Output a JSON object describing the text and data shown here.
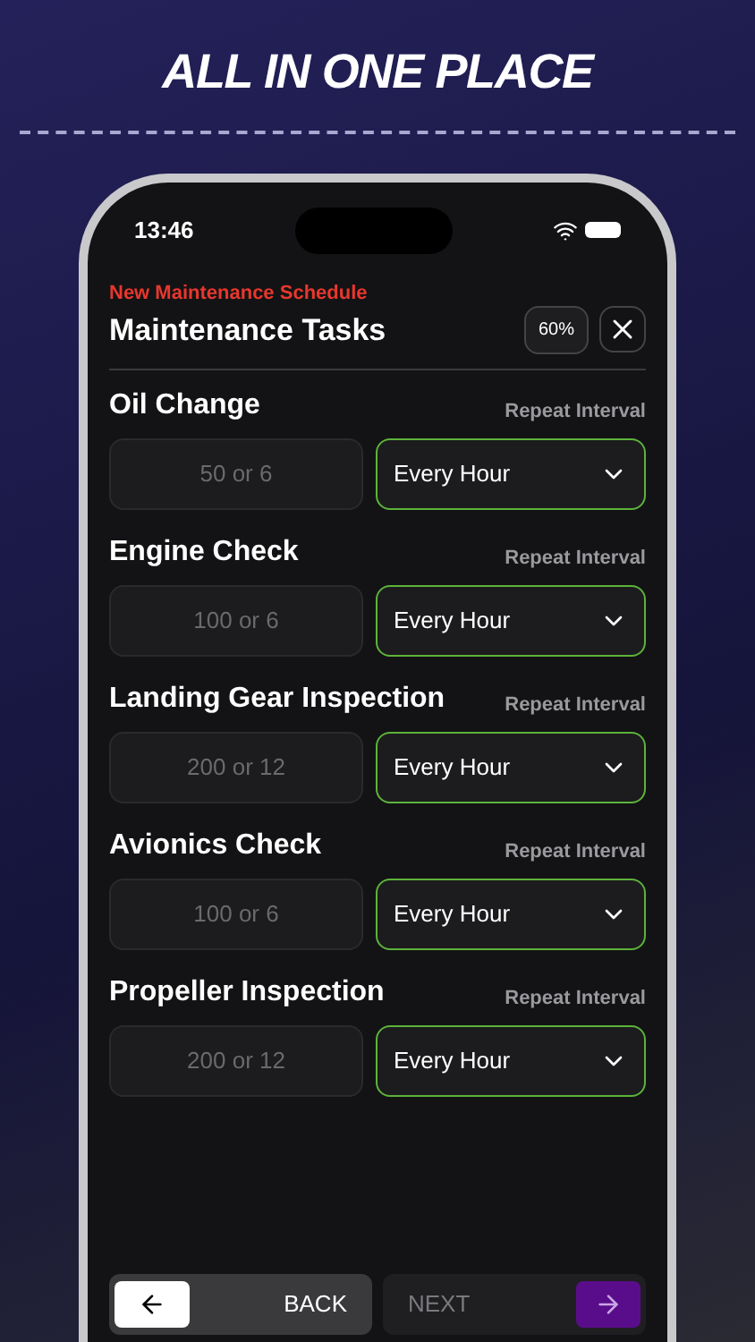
{
  "headline": "ALL IN ONE PLACE",
  "status_bar": {
    "time": "13:46"
  },
  "header": {
    "subtitle": "New Maintenance Schedule",
    "title": "Maintenance Tasks",
    "progress": "60%"
  },
  "tasks": [
    {
      "name": "Oil Change",
      "interval_label": "Repeat Interval",
      "placeholder": "50 or 6",
      "interval": "Every Hour"
    },
    {
      "name": "Engine Check",
      "interval_label": "Repeat Interval",
      "placeholder": "100 or 6",
      "interval": "Every Hour"
    },
    {
      "name": "Landing Gear Inspection",
      "interval_label": "Repeat Interval",
      "placeholder": "200 or 12",
      "interval": "Every Hour"
    },
    {
      "name": "Avionics Check",
      "interval_label": "Repeat Interval",
      "placeholder": "100 or 6",
      "interval": "Every Hour"
    },
    {
      "name": "Propeller Inspection",
      "interval_label": "Repeat Interval",
      "placeholder": "200 or 12",
      "interval": "Every Hour"
    }
  ],
  "footer": {
    "back": {
      "label": "BACK",
      "disabled": false
    },
    "next": {
      "label": "NEXT",
      "disabled": true
    }
  }
}
